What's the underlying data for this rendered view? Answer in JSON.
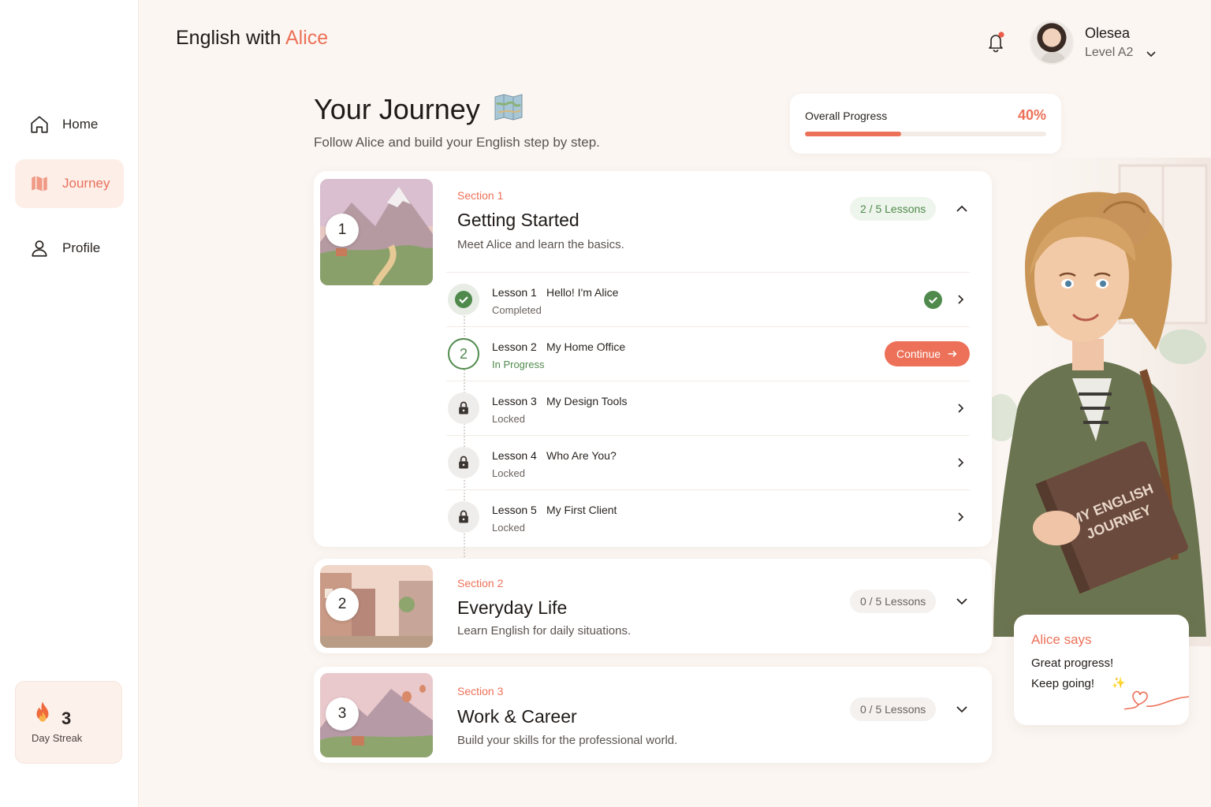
{
  "brand": {
    "prefix": "English with",
    "accent": "Alice"
  },
  "nav": {
    "home": "Home",
    "journey": "Journey",
    "profile": "Profile"
  },
  "streak": {
    "count": "3",
    "label": "Day Streak"
  },
  "user": {
    "name": "Olesea",
    "level": "Level A2"
  },
  "page": {
    "title": "Your Journey",
    "subtitle": "Follow Alice and build your English step by step."
  },
  "progress": {
    "label": "Overall Progress",
    "value_text": "40%",
    "fraction": 0.4
  },
  "sections": [
    {
      "number": "1",
      "kicker": "Section 1",
      "title": "Getting Started",
      "description": "Meet Alice and learn the basics.",
      "lessons_badge": "2 / 5 Lessons",
      "expanded": true,
      "lessons": [
        {
          "num": "Lesson 1",
          "name": "Hello! I'm Alice",
          "status": "Completed",
          "state": "completed",
          "icon_text": ""
        },
        {
          "num": "Lesson 2",
          "name": "My Home Office",
          "status": "In Progress",
          "state": "in-progress",
          "icon_text": "2"
        },
        {
          "num": "Lesson 3",
          "name": "My Design Tools",
          "status": "Locked",
          "state": "locked",
          "icon_text": ""
        },
        {
          "num": "Lesson 4",
          "name": "Who Are You?",
          "status": "Locked",
          "state": "locked",
          "icon_text": ""
        },
        {
          "num": "Lesson 5",
          "name": "My First Client",
          "status": "Locked",
          "state": "locked",
          "icon_text": ""
        }
      ],
      "continue_label": "Continue"
    },
    {
      "number": "2",
      "kicker": "Section 2",
      "title": "Everyday Life",
      "description": "Learn English for daily situations.",
      "lessons_badge": "0 / 5 Lessons",
      "expanded": false
    },
    {
      "number": "3",
      "kicker": "Section 3",
      "title": "Work & Career",
      "description": "Build your skills for the professional world.",
      "lessons_badge": "0 / 5 Lessons",
      "expanded": false
    }
  ],
  "illustration_text": {
    "book_line1": "MY ENGLISH",
    "book_line2": "JOURNEY"
  },
  "alice_card": {
    "title": "Alice says",
    "line1": "Great progress!",
    "line2": "Keep going!"
  },
  "colors": {
    "accent": "#ec7158",
    "success": "#4f8a4c",
    "background": "#fbf6f2"
  },
  "icons": [
    "home-icon",
    "map-icon",
    "user-icon",
    "fire-icon",
    "bell-icon",
    "chevron-down-icon",
    "chevron-up-icon",
    "chevron-right-icon",
    "check-icon",
    "lock-icon",
    "arrow-right-icon"
  ]
}
